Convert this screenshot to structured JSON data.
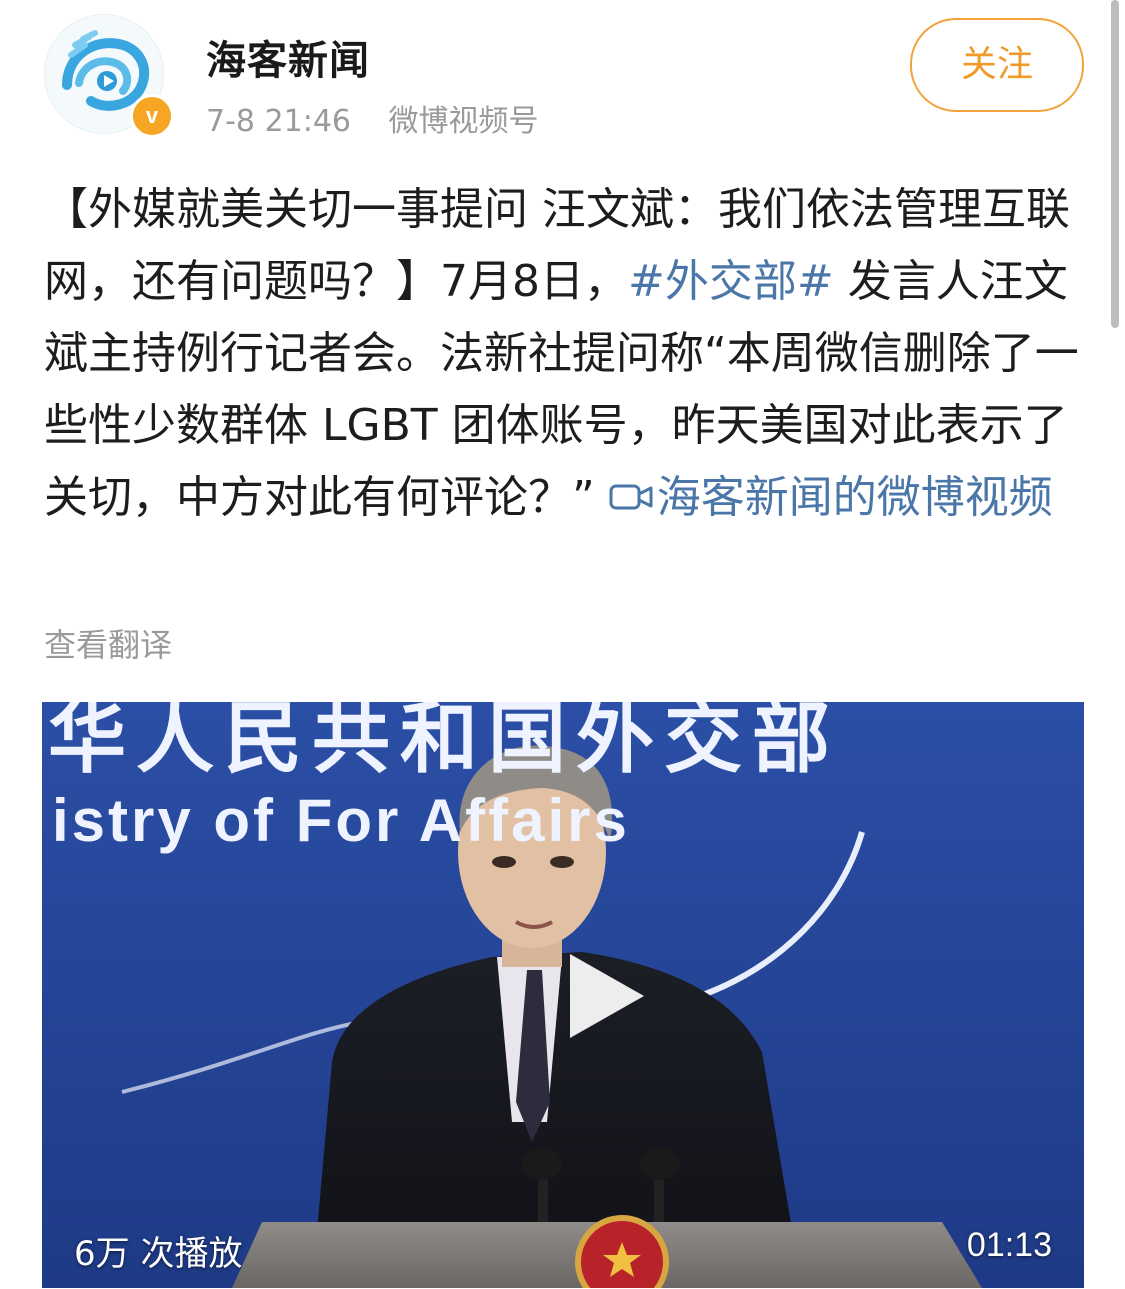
{
  "post": {
    "author": "海客新闻",
    "time": "7-8 21:46",
    "source": "微博视频号",
    "follow_label": "关注",
    "verified_mark": "v",
    "text_part1": "【外媒就美关切一事提问 汪文斌：我们依法管理互联网，还有问题吗？】7月8日，",
    "hashtag": "#外交部#",
    "text_part2": " 发言人汪文斌主持例行记者会。法新社提问称“本周微信删除了一些性少数群体 LGBT 团体账号，昨天美国对此表示了关切，中方对此有何评论？” ",
    "video_link": "海客新闻的微博视频",
    "translate_label": "查看翻译"
  },
  "video": {
    "banner_cn": "华人民共和国外交部",
    "banner_en": "istry of For       Affairs",
    "views": "6万 次播放",
    "duration": "01:13"
  },
  "icons": {
    "avatar": "haike-news-logo",
    "verified": "verified-badge-icon",
    "video_link": "video-camera-icon",
    "play": "play-icon"
  },
  "colors": {
    "accent_orange": "#f09a2a",
    "link_blue": "#4a76a8",
    "meta_gray": "#9a9a9a"
  }
}
